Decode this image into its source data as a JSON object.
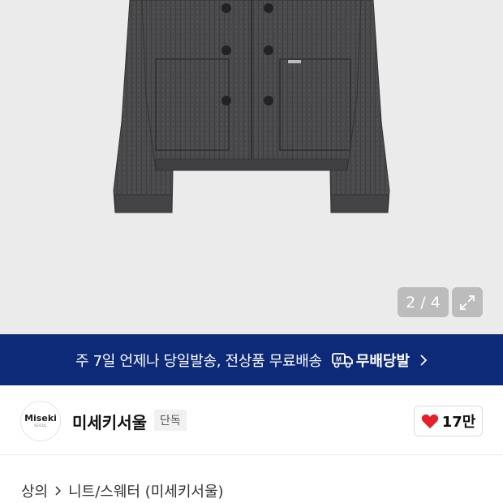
{
  "gallery": {
    "counter_text": "2 / 4",
    "icons": {
      "expand": "expand-arrows-icon"
    }
  },
  "banner": {
    "text": "주 7일 언제나 당일발송, 전상품 무료배송",
    "badge_icon": "delivery-truck-icon",
    "badge_label": "무배당발",
    "chevron_icon": "chevron-right-icon",
    "background_color": "#0d2a78"
  },
  "brand": {
    "logo_main": "Miseki",
    "logo_sub": "SEOUL",
    "name": "미세키서울",
    "tag": "단독"
  },
  "like": {
    "icon": "heart-icon",
    "count": "17만",
    "heart_color": "#e5202b"
  },
  "breadcrumb": {
    "category": "상의",
    "subcategory": "니트/스웨터 (미세키서울)",
    "separator_icon": "chevron-right-icon"
  }
}
